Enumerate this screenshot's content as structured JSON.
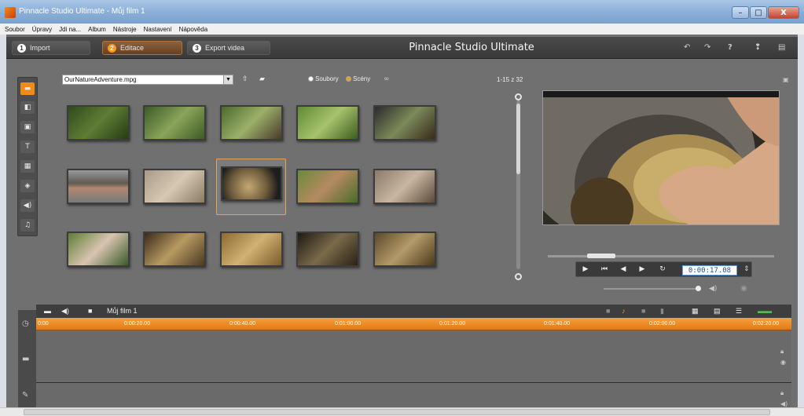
{
  "window": {
    "title": "Pinnacle Studio Ultimate - Můj film 1",
    "min_label": "–",
    "max_label": "□",
    "close_label": "X"
  },
  "menu": [
    "Soubor",
    "Úpravy",
    "Jdi na...",
    "Album",
    "Nástroje",
    "Nastavení",
    "Nápověda"
  ],
  "nav": {
    "tabs": [
      {
        "num": "1",
        "label": "Import"
      },
      {
        "num": "2",
        "label": "Editace"
      },
      {
        "num": "3",
        "label": "Export videa"
      }
    ],
    "active_tab": "Editace",
    "app_title": "Pinnacle Studio Ultimate"
  },
  "album": {
    "file": "OurNatureAdventure.mpg",
    "view_files": "Soubory",
    "view_scenes": "Scény",
    "counter": "1-15 z 32"
  },
  "player": {
    "timecode": "0:00:17.08"
  },
  "timeline": {
    "project": "Můj film 1",
    "ruler": [
      "0:00",
      "0:00:20.00",
      "0:00:40.00",
      "0:01:00.00",
      "0:01:20.00",
      "0:01:40.00",
      "0:02:00.00",
      "0:02:20.00"
    ]
  },
  "colors": {
    "accent": "#f08a1a",
    "timeline_ruler": "#ee8a22",
    "panel": "#707070"
  }
}
